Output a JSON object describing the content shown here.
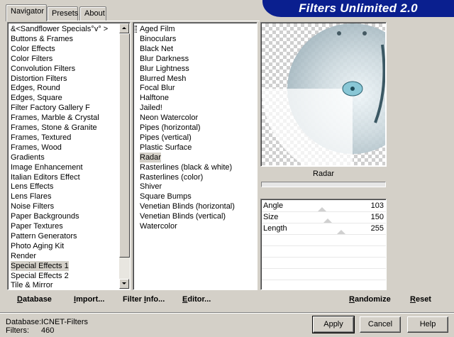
{
  "tabs": [
    {
      "label": "Navigator",
      "active": true
    },
    {
      "label": "Presets",
      "active": false
    },
    {
      "label": "About",
      "active": false
    }
  ],
  "banner_title": "Filters Unlimited 2.0",
  "categories": [
    "&<Sandflower Specials°v° >",
    "Buttons & Frames",
    "Color Effects",
    "Color Filters",
    "Convolution Filters",
    "Distortion Filters",
    "Edges, Round",
    "Edges, Square",
    "Filter Factory Gallery F",
    "Frames, Marble & Crystal",
    "Frames, Stone & Granite",
    "Frames, Textured",
    "Frames, Wood",
    "Gradients",
    "Image Enhancement",
    "Italian Editors Effect",
    "Lens Effects",
    "Lens Flares",
    "Noise Filters",
    "Paper Backgrounds",
    "Paper Textures",
    "Pattern Generators",
    "Photo Aging Kit",
    "Render",
    "Special Effects 1",
    "Special Effects 2",
    "Tile & Mirror"
  ],
  "selected_category": "Special Effects 1",
  "filters": [
    "Aged Film",
    "Binoculars",
    "Black Net",
    "Blur Darkness",
    "Blur Lightness",
    "Blurred Mesh",
    "Focal Blur",
    "Halftone",
    "Jailed!",
    "Neon Watercolor",
    "Pipes (horizontal)",
    "Pipes (vertical)",
    "Plastic Surface",
    "Radar",
    "Rasterlines (black & white)",
    "Rasterlines (color)",
    "Shiver",
    "Square Bumps",
    "Venetian Blinds (horizontal)",
    "Venetian Blinds (vertical)",
    "Watercolor"
  ],
  "selected_filter": "Radar",
  "preview_caption": "Radar",
  "params": [
    {
      "label": "Angle",
      "value": "103",
      "level": 103
    },
    {
      "label": "Size",
      "value": "150",
      "level": 150
    },
    {
      "label": "Length",
      "value": "255",
      "level": 255
    }
  ],
  "actions": {
    "database": {
      "u": "D",
      "rest": "atabase"
    },
    "import": {
      "u": "I",
      "rest": "mport..."
    },
    "filter_info": {
      "pre": "Filter ",
      "u": "I",
      "rest": "nfo..."
    },
    "editor": {
      "u": "E",
      "rest": "ditor..."
    },
    "randomize": {
      "pre": "",
      "u": "R",
      "rest": "andomize"
    },
    "reset": {
      "u": "R",
      "rest": "eset"
    }
  },
  "status": {
    "database_label": "Database:",
    "database_value": "ICNET-Filters",
    "filters_label": "Filters:",
    "filters_value": "460"
  },
  "buttons": {
    "apply": "Apply",
    "cancel": "Cancel",
    "help": "Help"
  },
  "colors": {
    "banner_bg": "#0a1f8f",
    "dialog_bg": "#d4d0c8",
    "selection_bg": "#d4d0c8"
  }
}
